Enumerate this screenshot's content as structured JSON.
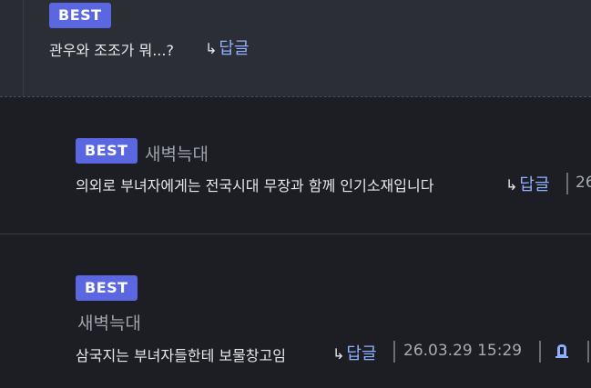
{
  "comments": [
    {
      "badge": "BEST",
      "author": "",
      "text": "관우와 조조가 뭐...?",
      "reply_arrow": "↳",
      "reply_label": "답글"
    },
    {
      "badge": "BEST",
      "author": "새벽늑대",
      "text": "의외로 부녀자에게는 전국시대 무장과 함께 인기소재입니다",
      "reply_arrow": "↳",
      "reply_label": "답글",
      "date_partial": "26"
    },
    {
      "badge": "BEST",
      "author": "새벽늑대",
      "text": "삼국지는 부녀자들한테 보물창고임",
      "reply_arrow": "↳",
      "reply_label": "답글",
      "date": "26.03.29 15:29",
      "icon": "bell-icon"
    }
  ],
  "colors": {
    "badge": "#5b67e0",
    "reply": "#8fb0ff",
    "text": "#e7e8ea",
    "muted": "#9ea2ab"
  }
}
